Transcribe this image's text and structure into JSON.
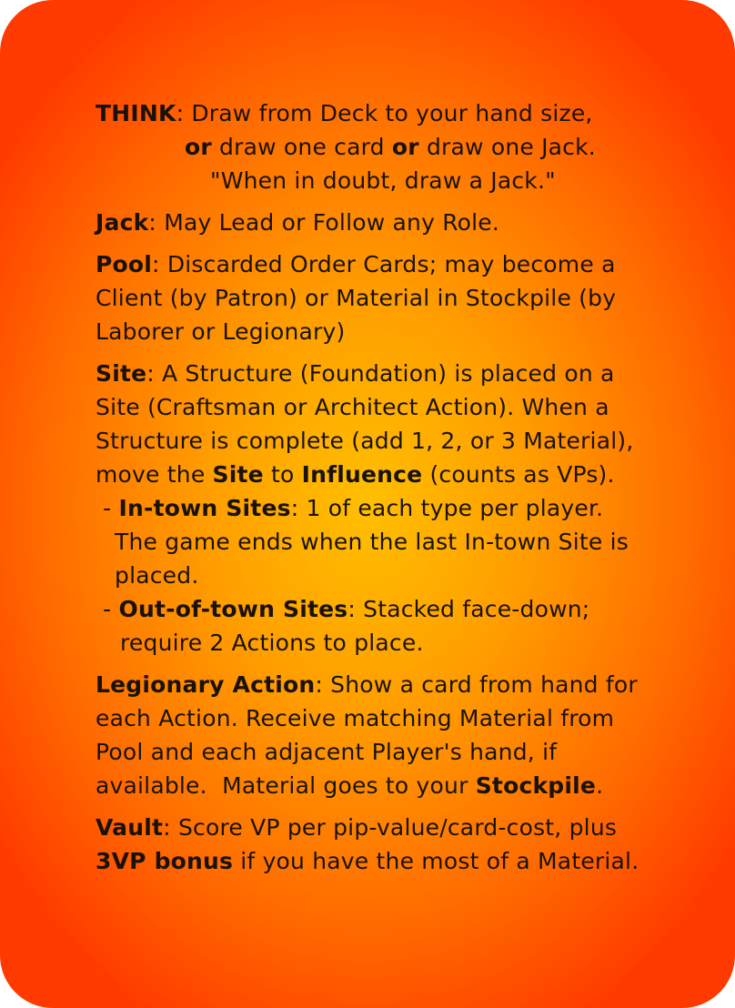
{
  "think": {
    "term": "THINK",
    "l1": ": Draw from Deck to your hand size,",
    "or1": "or",
    "l2a": " draw one card ",
    "or2": "or",
    "l2b": " draw one Jack.",
    "l3": "\"When in doubt, draw a Jack.\""
  },
  "jack": {
    "term": "Jack",
    "text": ": May Lead or Follow any Role."
  },
  "pool": {
    "term": "Pool",
    "l1": ": Discarded Order Cards; may become a",
    "l2": "Client (by Patron) or Material in Stockpile (by",
    "l3": "Laborer or Legionary)"
  },
  "site": {
    "term": "Site",
    "l1": ": A Structure (Foundation) is placed on a",
    "l2": "Site (Craftsman or Architect Action). When a",
    "l3": "Structure is complete (add 1, 2, or 3 Material),",
    "l4a": "move the ",
    "l4b": "Site",
    "l4c": " to ",
    "l4d": "Influence",
    "l4e": " (counts as VPs).",
    "intown_dash": " - ",
    "intown_term": "In-town Sites",
    "intown_l1": ": 1 of each type per player.",
    "intown_l2": "The game ends when the last In-town Site is",
    "intown_l3": "placed.",
    "outtown_dash": " - ",
    "outtown_term": "Out-of-town Sites",
    "outtown_l1": ": Stacked face-down;",
    "outtown_l2": "require 2 Actions to place."
  },
  "legionary": {
    "term": "Legionary Action",
    "l1": ": Show a card from hand for",
    "l2": "each Action. Receive matching Material from",
    "l3": "Pool and each adjacent Player's hand, if",
    "l4a": "available.  Material goes to your ",
    "l4b": "Stockpile",
    "l4c": "."
  },
  "vault": {
    "term": "Vault",
    "l1": ": Score VP per pip-value/card-cost, plus",
    "l2a": "3VP bonus",
    "l2b": " if you have the most of a Material."
  }
}
